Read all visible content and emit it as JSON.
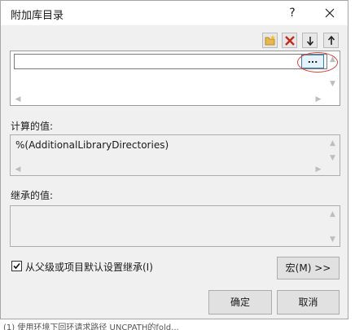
{
  "dialog": {
    "title": "附加库目录",
    "help_label": "?"
  },
  "toolbar": {
    "new_line": "folder-new-icon",
    "delete": "delete-icon",
    "move_down": "arrow-down-icon",
    "move_up": "arrow-up-icon",
    "delete_color": "#c42b1c"
  },
  "entry": {
    "value": "",
    "browse_label": "..."
  },
  "evaluated": {
    "label": "计算的值:",
    "value": "%(AdditionalLibraryDirectories)"
  },
  "inherited": {
    "label": "继承的值:",
    "value": ""
  },
  "inherit_checkbox": {
    "label": "从父级或项目默认设置继承(I)",
    "checked": true
  },
  "buttons": {
    "macros": "宏(M) >>",
    "ok": "确定",
    "cancel": "取消"
  },
  "background_text": "(1) 使用环境下回环请求路径 UNCPATH的fold..."
}
